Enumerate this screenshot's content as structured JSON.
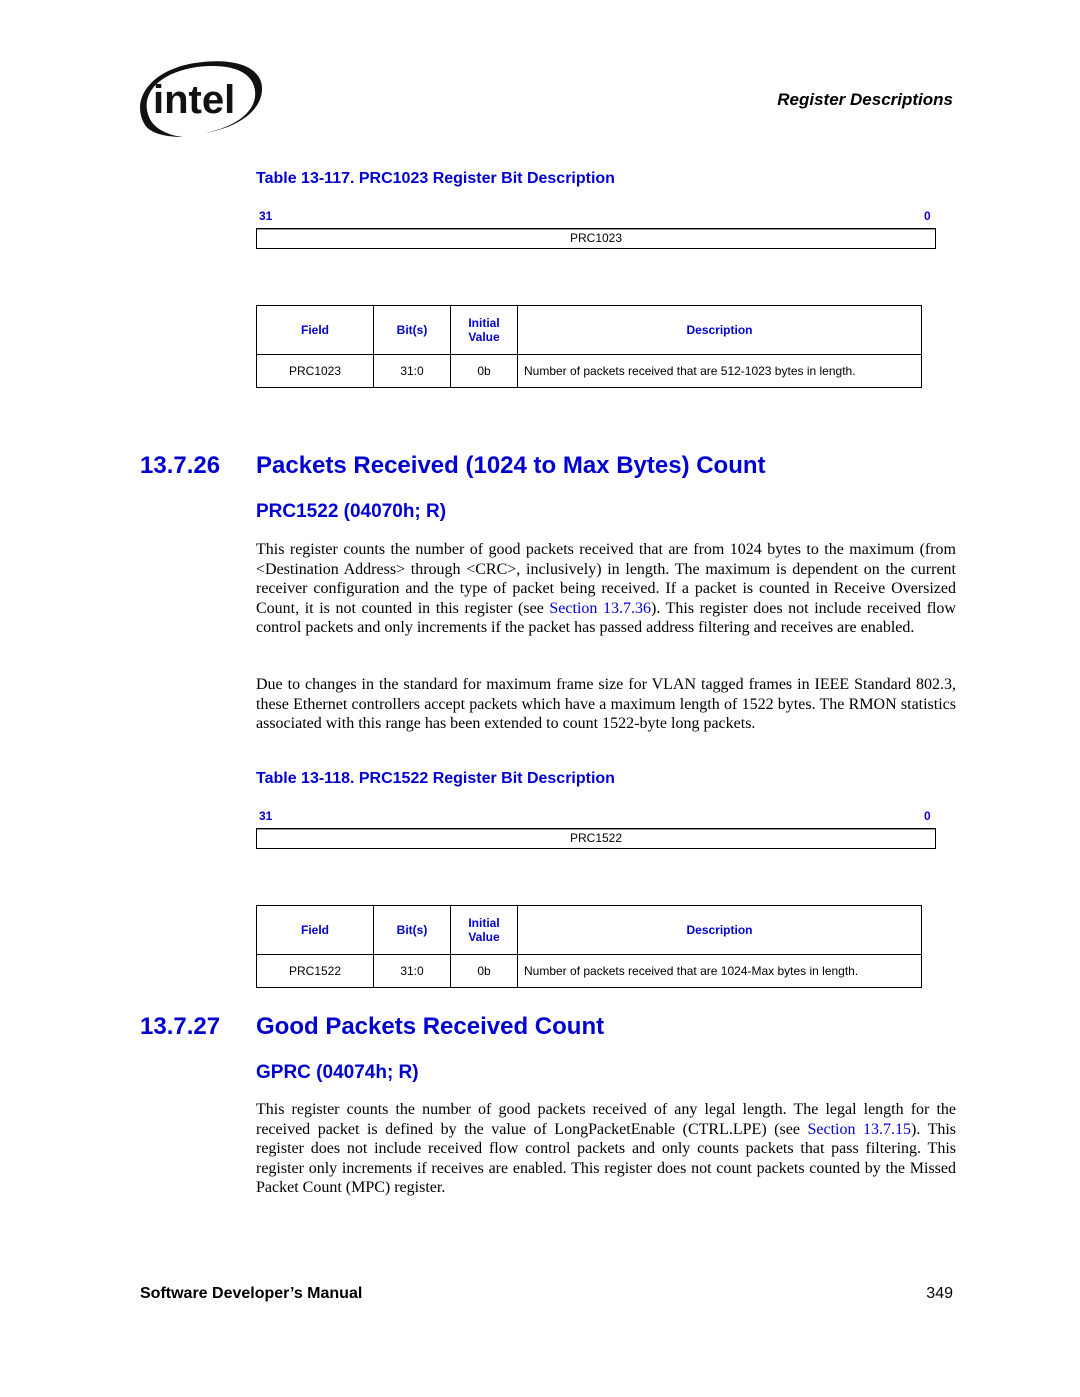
{
  "header": {
    "logo_text": "intel",
    "running_head": "Register Descriptions"
  },
  "table117": {
    "caption": "Table 13-117. PRC1023 Register Bit Description",
    "bit_high": "31",
    "bit_low": "0",
    "register_name": "PRC1023",
    "columns": [
      "Field",
      "Bit(s)",
      "Initial Value",
      "Description"
    ],
    "columns_initial_line1": "Initial",
    "columns_initial_line2": "Value",
    "rows": [
      {
        "field": "PRC1023",
        "bits": "31:0",
        "initial": "0b",
        "description": "Number of packets received that are 512-1023 bytes in length."
      }
    ]
  },
  "section26": {
    "number": "13.7.26",
    "title": "Packets Received (1024 to Max Bytes) Count",
    "register": "PRC1522 (04070h; R)",
    "para1_a": "This register counts the number of good packets received that are from 1024 bytes to the maximum (from <Destination Address> through <CRC>, inclusively) in length. The maximum is dependent on the current receiver configuration and the type of packet being received. If a packet is counted in Receive Oversized Count, it is not counted in this register (see ",
    "para1_link": "Section 13.7.36",
    "para1_b": "). This register does not include received flow control packets and only increments if the packet has passed address filtering and receives are enabled.",
    "para2": "Due to changes in the standard for maximum frame size for VLAN tagged frames in IEEE Standard 802.3, these Ethernet controllers accept packets which have a maximum length of 1522 bytes. The RMON statistics associated with this range has been extended to count 1522-byte long packets."
  },
  "table118": {
    "caption": "Table 13-118. PRC1522 Register Bit Description",
    "bit_high": "31",
    "bit_low": "0",
    "register_name": "PRC1522",
    "columns": [
      "Field",
      "Bit(s)",
      "Initial Value",
      "Description"
    ],
    "columns_initial_line1": "Initial",
    "columns_initial_line2": "Value",
    "rows": [
      {
        "field": "PRC1522",
        "bits": "31:0",
        "initial": "0b",
        "description": "Number of packets received that are 1024-Max bytes in length."
      }
    ]
  },
  "section27": {
    "number": "13.7.27",
    "title": "Good Packets Received Count",
    "register": "GPRC (04074h; R)",
    "para1_a": "This register counts the number of good packets received of any legal length. The legal length for the received packet is defined by the value of LongPacketEnable (CTRL.LPE) (see ",
    "para1_link": "Section 13.7.15",
    "para1_b": "). This register does not include received flow control packets and only counts packets that pass filtering. This register only increments if receives are enabled. This register does not count packets counted by the Missed Packet Count (MPC) register."
  },
  "footer": {
    "title": "Software Developer’s Manual",
    "page": "349"
  }
}
